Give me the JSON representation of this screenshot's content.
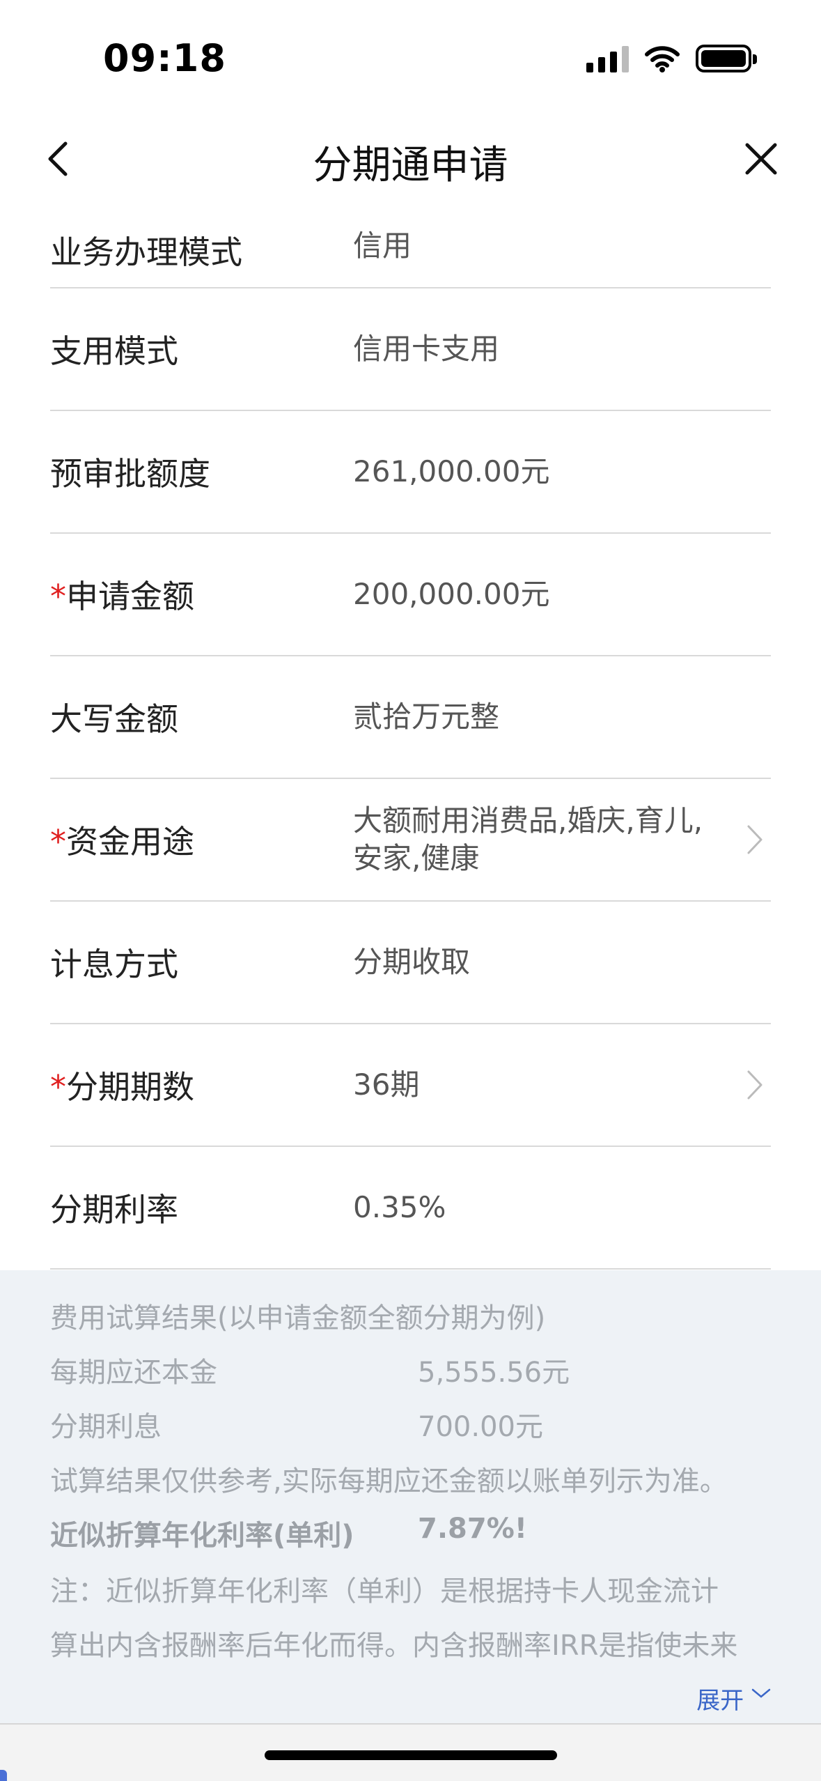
{
  "status_bar": {
    "time": "09:18"
  },
  "nav": {
    "title": "分期通申请"
  },
  "form": {
    "rows": [
      {
        "label": "业务办理模式",
        "value": "信用"
      },
      {
        "label": "支用模式",
        "value": "信用卡支用"
      },
      {
        "label": "预审批额度",
        "value": "261,000.00元"
      },
      {
        "label": "申请金额",
        "value": "200,000.00元",
        "required": true
      },
      {
        "label": "大写金额",
        "value": "贰拾万元整"
      },
      {
        "label": "资金用途",
        "value": "大额耐用消费品,婚庆,育儿,安家,健康",
        "required": true
      },
      {
        "label": "计息方式",
        "value": "分期收取"
      },
      {
        "label": "分期期数",
        "value": "36期",
        "required": true
      },
      {
        "label": "分期利率",
        "value": "0.35%"
      }
    ],
    "required_mark": "*"
  },
  "calc": {
    "title": "费用试算结果(以申请金额全额分期为例)",
    "principal_label": "每期应还本金",
    "principal_value": "5,555.56元",
    "interest_label": "分期利息",
    "interest_value": "700.00元",
    "disclaimer": "试算结果仅供参考,实际每期应还金额以账单列示为准。",
    "apr_label": "近似折算年化利率(单利)",
    "apr_value": "7.87%!",
    "note_line1": " 注：近似折算年化利率（单利）是根据持卡人现金流计",
    "note_line2": "算出内含报酬率后年化而得。内含报酬率IRR是指使未来",
    "expand_label": "展开"
  },
  "colors": {
    "required": "#e02020",
    "link": "#3a66c8",
    "panel_bg": "#eef2f6"
  },
  "icons": [
    "back-arrow-icon",
    "close-icon",
    "chevron-right-icon",
    "signal-icon",
    "wifi-icon",
    "battery-icon"
  ]
}
